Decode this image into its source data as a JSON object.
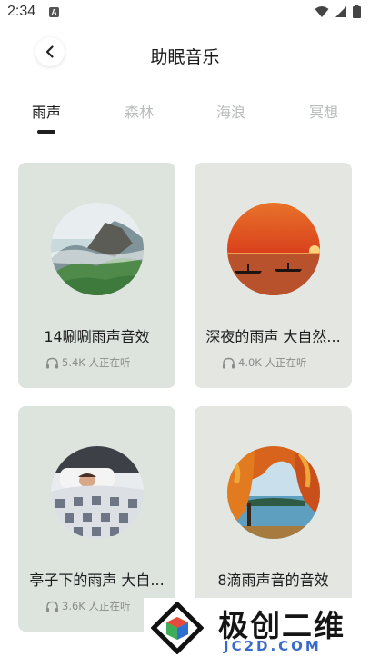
{
  "status_bar": {
    "time": "2:34",
    "notification_letter": "A",
    "icons": [
      "wifi-icon",
      "signal-icon",
      "battery-icon"
    ]
  },
  "header": {
    "title": "助眠音乐",
    "back_icon": "chevron-left-icon"
  },
  "tabs": [
    {
      "label": "雨声",
      "active": true
    },
    {
      "label": "森林",
      "active": false
    },
    {
      "label": "海浪",
      "active": false
    },
    {
      "label": "冥想",
      "active": false
    }
  ],
  "cards": [
    {
      "title": "14唰唰雨声音效",
      "listeners": "5.4K 人正在听",
      "image": "misty-mountain-cliff"
    },
    {
      "title": "深夜的雨声 大自然...",
      "listeners": "4.0K 人正在听",
      "image": "sunset-over-water-boats"
    },
    {
      "title": "亭子下的雨声 大自...",
      "listeners": "3.6K 人正在听",
      "image": "person-sleeping-in-bed"
    },
    {
      "title": "8滴雨声音的音效",
      "listeners": "",
      "image": "autumn-trees-lake"
    }
  ],
  "watermark": {
    "text": "极创二维",
    "sub": "JC2D.COM"
  },
  "colors": {
    "card_green": "#dde4de",
    "card_gray": "#e3e6e1",
    "tab_inactive": "#b9bdbb",
    "text_dark": "#1b1b1b",
    "meta_gray": "#8a8d8b",
    "watermark_blue": "#3a6bc8"
  }
}
